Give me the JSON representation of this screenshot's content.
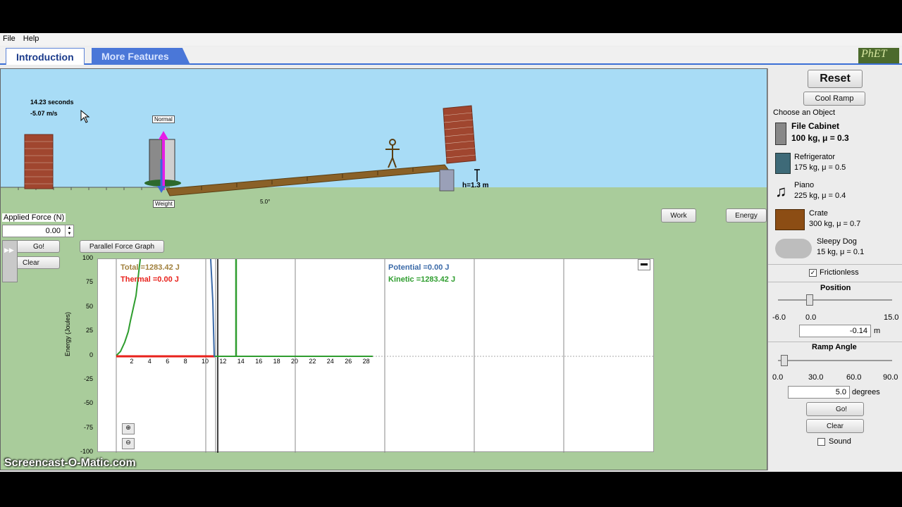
{
  "menu": {
    "file": "File",
    "help": "Help"
  },
  "tabs": {
    "intro": "Introduction",
    "more": "More Features"
  },
  "logo": "PhET",
  "readout": {
    "time": "14.23 seconds",
    "velocity": "-5.07 m/s"
  },
  "vectors": {
    "normal": "Normal",
    "weight": "Weight"
  },
  "ramp": {
    "angle_label": "5.0°",
    "height_label": "h=1.3 m"
  },
  "applied": {
    "label": "Applied Force (N)",
    "value": "0.00",
    "go": "Go!",
    "clear": "Clear"
  },
  "parallel_force_button": "Parallel Force Graph",
  "side_buttons": {
    "work": "Work",
    "energy": "Energy"
  },
  "graph": {
    "legend": {
      "total": "Total =1283.42 J",
      "thermal": "Thermal =0.00 J",
      "potential": "Potential =0.00 J",
      "kinetic": "Kinetic =1283.42 J"
    },
    "ylabel": "Energy (Joules)",
    "yticks": [
      "100",
      "75",
      "50",
      "25",
      "0",
      "-25",
      "-50",
      "-75",
      "-100"
    ],
    "xticks": [
      "2",
      "4",
      "6",
      "8",
      "10",
      "12",
      "14",
      "16",
      "18",
      "20",
      "22",
      "24",
      "26",
      "28"
    ],
    "colors": {
      "total": "#a07f3b",
      "thermal": "#e8211b",
      "potential": "#3b6aa8",
      "kinetic": "#2e9d2e"
    }
  },
  "controls": {
    "reset": "Reset",
    "cool_ramp": "Cool Ramp",
    "choose_object": "Choose an Object",
    "objects": [
      {
        "name": "File Cabinet",
        "spec": "100 kg, μ = 0.3",
        "selected": true,
        "icon": "file-cabinet-icon"
      },
      {
        "name": "Refrigerator",
        "spec": "175 kg, μ = 0.5",
        "icon": "refrigerator-icon"
      },
      {
        "name": "Piano",
        "spec": "225 kg, μ = 0.4",
        "icon": "piano-icon"
      },
      {
        "name": "Crate",
        "spec": "300 kg, μ = 0.7",
        "icon": "crate-icon"
      },
      {
        "name": "Sleepy Dog",
        "spec": "15 kg, μ = 0.1",
        "icon": "dog-icon"
      }
    ],
    "frictionless": "Frictionless",
    "position": {
      "label": "Position",
      "min": "-6.0",
      "mid": "0.0",
      "max": "15.0",
      "value": "-0.14",
      "unit": "m",
      "level": -0.14
    },
    "ramp_angle": {
      "label": "Ramp Angle",
      "ticks": [
        "0.0",
        "30.0",
        "60.0",
        "90.0"
      ],
      "value": "5.0",
      "unit": "degrees",
      "level": 5.0
    },
    "go": "Go!",
    "clear": "Clear",
    "sound": "Sound"
  },
  "watermark": "Screencast-O-Matic.com"
}
